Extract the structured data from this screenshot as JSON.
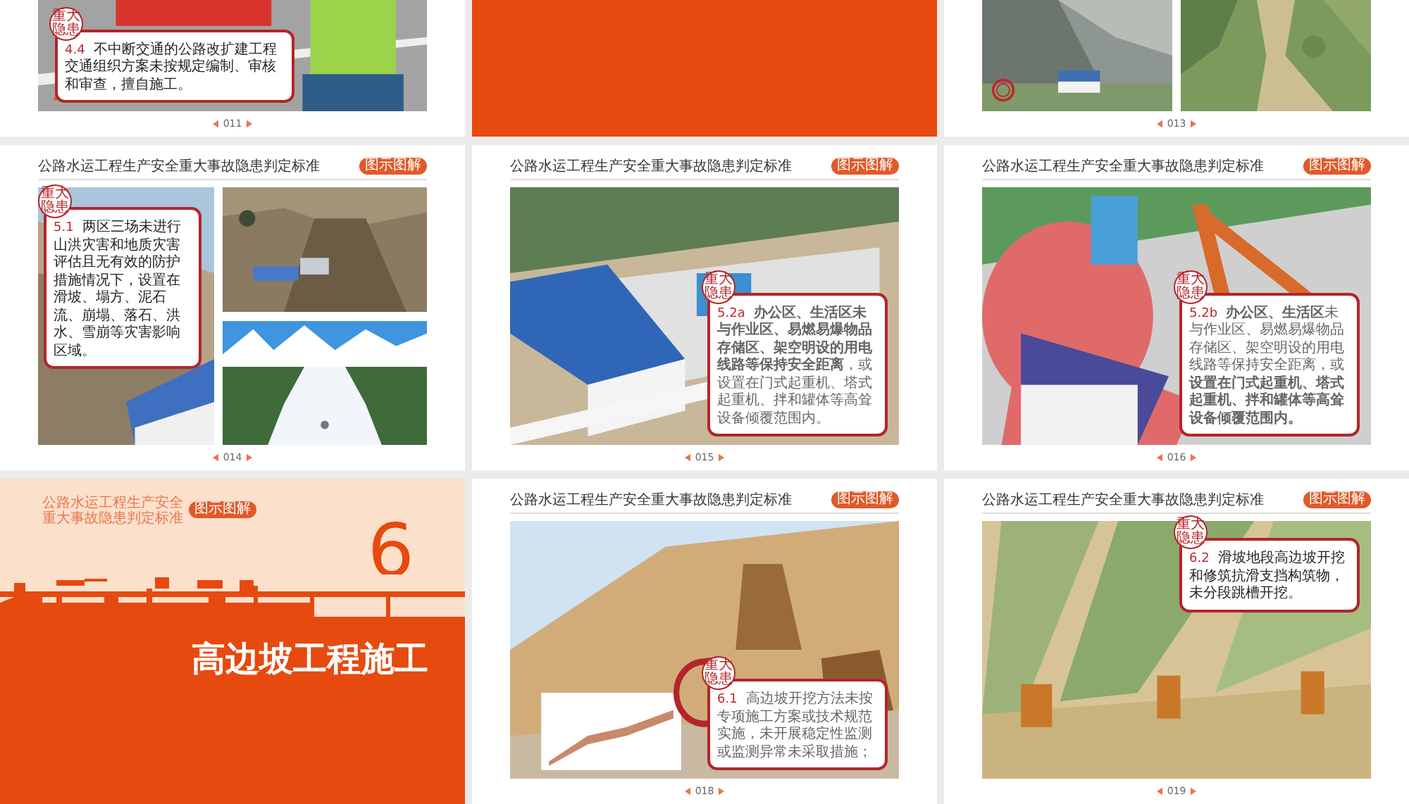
{
  "pages": [
    {
      "kind": "scene",
      "number": "011",
      "callout": {
        "stamp": "重大隐患",
        "code": "4.4",
        "text": "不中断交通的公路改扩建工程交通组织方案未按规定编制、审核和审查，擅自施工。"
      }
    },
    {
      "kind": "blank"
    },
    {
      "kind": "duo",
      "number": "013"
    },
    {
      "kind": "split",
      "number": "014",
      "header": "公路水运工程生产安全重大事故隐患判定标准",
      "badge": "图示图解",
      "callout": {
        "stamp": "重大隐患",
        "code": "5.1",
        "text": "两区三场未进行山洪灾害和地质灾害评估且无有效的防护措施情况下，设置在滑坡、塌方、泥石流、崩塌、落石、洪水、雪崩等灾害影响区域。"
      }
    },
    {
      "kind": "scene",
      "number": "015",
      "header": "公路水运工程生产安全重大事故隐患判定标准",
      "badge": "图示图解",
      "callout": {
        "stamp": "重大隐患",
        "code": "5.2a",
        "text": "**办公区、生活区未与作业区、易燃易爆物品存储区、架空明设的用电线路等保持安全距离**，或设置在门式起重机、塔式起重机、拌和罐体等高耸设备倾覆范围内。"
      }
    },
    {
      "kind": "scene",
      "number": "016",
      "header": "公路水运工程生产安全重大事故隐患判定标准",
      "badge": "图示图解",
      "callout": {
        "stamp": "重大隐患",
        "code": "5.2b",
        "text": "**办公区、生活区**未与作业区、易燃易爆物品存储区、架空明设的用电线路等保持安全距离，或**设置在门式起重机、塔式起重机、拌和罐体等高耸设备倾覆范围内。**"
      }
    },
    {
      "kind": "chapter",
      "book": [
        "公路水运工程生产安全",
        "重大事故隐患判定标准"
      ],
      "badge": "图示图解",
      "chapter_number": "6",
      "title": "高边坡工程施工"
    },
    {
      "kind": "scene",
      "number": "018",
      "header": "公路水运工程生产安全重大事故隐患判定标准",
      "badge": "图示图解",
      "callout": {
        "stamp": "重大隐患",
        "code": "6.1",
        "text": "高边坡开挖方法未按专项施工方案或技术规范实施，未开展稳定性监测或监测异常未采取措施；"
      }
    },
    {
      "kind": "scene",
      "number": "019",
      "header": "公路水运工程生产安全重大事故隐患判定标准",
      "badge": "图示图解",
      "callout": {
        "stamp": "重大隐患",
        "code": "6.2",
        "text": "滑坡地段高边坡开挖和修筑抗滑支挡构筑物，未分段跳槽开挖。"
      }
    }
  ]
}
